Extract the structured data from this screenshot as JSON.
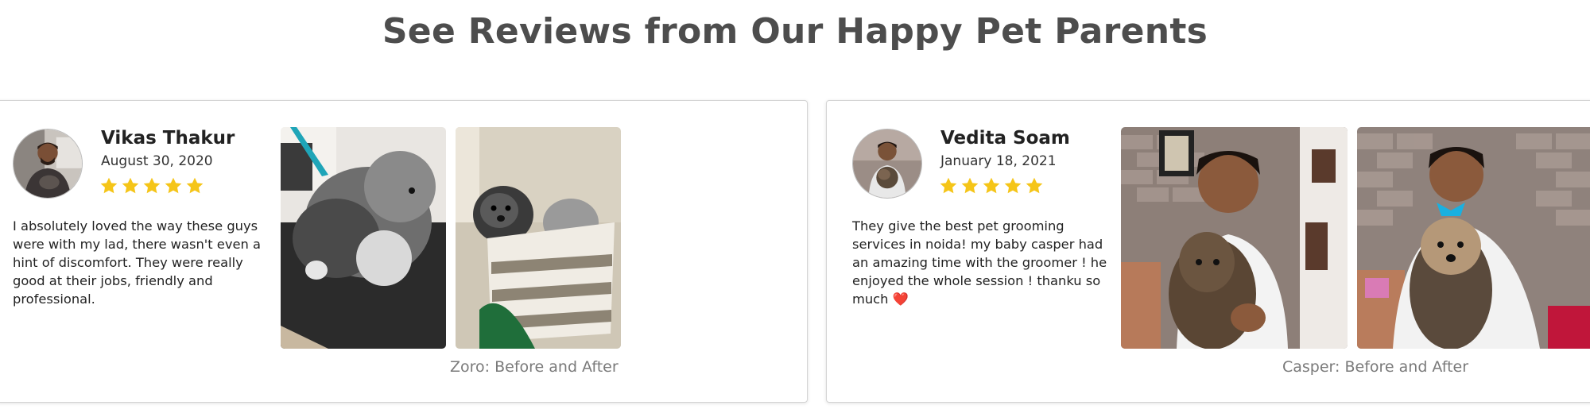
{
  "page": {
    "title": "See Reviews from Our Happy Pet Parents"
  },
  "reviews": [
    {
      "name": "Vikas Thakur",
      "date": "August 30, 2020",
      "rating": 5,
      "text": "I absolutely loved the way these guys were with my lad, there wasn't even a hint of discomfort. They were really good at their jobs, friendly and professional.",
      "caption": "Zoro: Before and After"
    },
    {
      "name": "Vedita Soam",
      "date": "January 18, 2021",
      "rating": 5,
      "text": "They give the best pet grooming services in noida! my baby casper had an amazing time with the groomer ! he enjoyed the whole session ! thanku so much",
      "emoji": "❤️",
      "caption": "Casper: Before and After"
    }
  ],
  "colors": {
    "title": "#4d4d4d",
    "star": "#f5c518",
    "caption": "#7a7a7a",
    "card_border": "#d4d4d4"
  },
  "icons": {
    "star": "star-icon",
    "heart": "heart-emoji"
  }
}
